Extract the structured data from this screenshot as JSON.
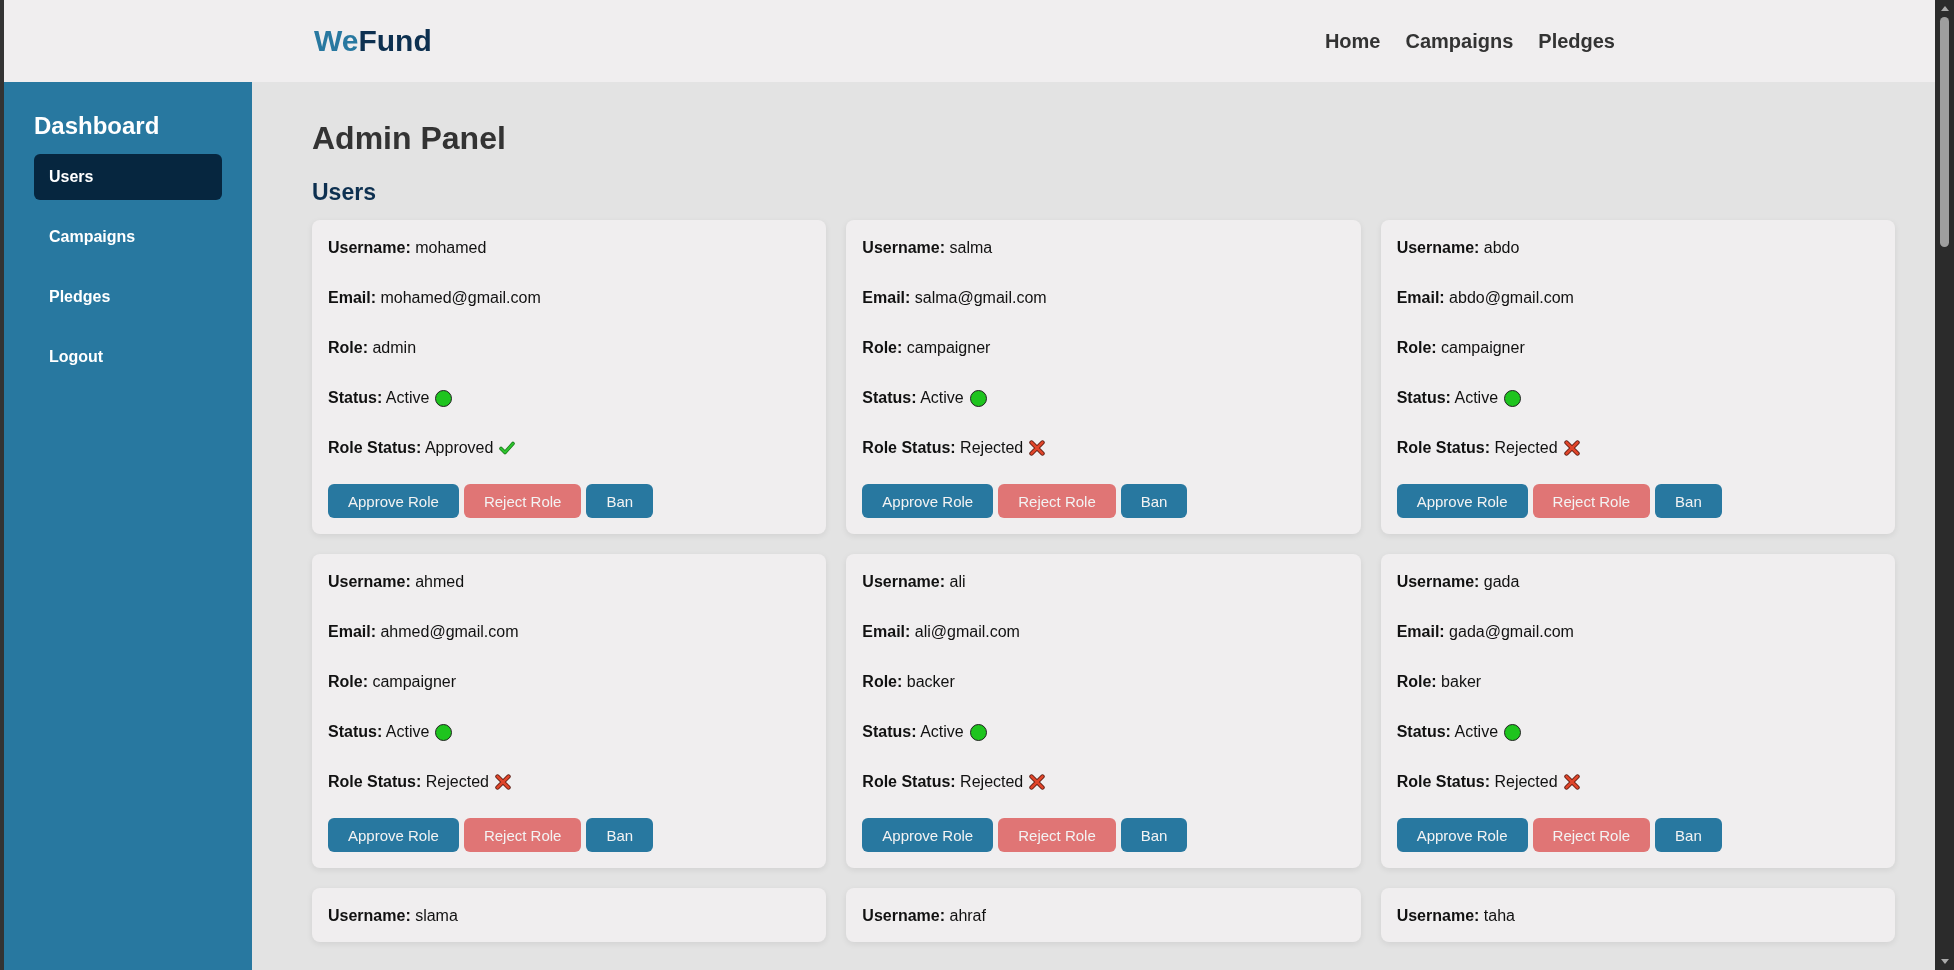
{
  "header": {
    "logo": {
      "first": "We",
      "second": "Fund"
    },
    "nav": [
      "Home",
      "Campaigns",
      "Pledges"
    ]
  },
  "sidebar": {
    "title": "Dashboard",
    "items": [
      {
        "label": "Users",
        "selected": true
      },
      {
        "label": "Campaigns",
        "selected": false
      },
      {
        "label": "Pledges",
        "selected": false
      },
      {
        "label": "Logout",
        "selected": false
      }
    ]
  },
  "main": {
    "title": "Admin Panel",
    "section": "Users",
    "users": [
      {
        "fields": [
          {
            "kind": "text",
            "label": "Username:",
            "value": "mohamed"
          },
          {
            "kind": "text",
            "label": "Email:",
            "value": "mohamed@gmail.com"
          },
          {
            "kind": "text",
            "label": "Role:",
            "value": "admin"
          },
          {
            "kind": "dot",
            "label": "Status:",
            "value": "Active",
            "color": "#1ec41e"
          },
          {
            "kind": "approved",
            "label": "Role Status:",
            "value": "Approved"
          }
        ],
        "buttons": [
          {
            "kind": "approve",
            "label": "Approve Role"
          },
          {
            "kind": "reject",
            "label": "Reject Role"
          },
          {
            "kind": "ban",
            "label": "Ban"
          }
        ]
      },
      {
        "fields": [
          {
            "kind": "text",
            "label": "Username:",
            "value": "salma"
          },
          {
            "kind": "text",
            "label": "Email:",
            "value": "salma@gmail.com"
          },
          {
            "kind": "text",
            "label": "Role:",
            "value": "campaigner"
          },
          {
            "kind": "dot",
            "label": "Status:",
            "value": "Active",
            "color": "#1ec41e"
          },
          {
            "kind": "rejected",
            "label": "Role Status:",
            "value": "Rejected"
          }
        ],
        "buttons": [
          {
            "kind": "approve",
            "label": "Approve Role"
          },
          {
            "kind": "reject",
            "label": "Reject Role"
          },
          {
            "kind": "ban",
            "label": "Ban"
          }
        ]
      },
      {
        "fields": [
          {
            "kind": "text",
            "label": "Username:",
            "value": "abdo"
          },
          {
            "kind": "text",
            "label": "Email:",
            "value": "abdo@gmail.com"
          },
          {
            "kind": "text",
            "label": "Role:",
            "value": "campaigner"
          },
          {
            "kind": "dot",
            "label": "Status:",
            "value": "Active",
            "color": "#1ec41e"
          },
          {
            "kind": "rejected",
            "label": "Role Status:",
            "value": "Rejected"
          }
        ],
        "buttons": [
          {
            "kind": "approve",
            "label": "Approve Role"
          },
          {
            "kind": "reject",
            "label": "Reject Role"
          },
          {
            "kind": "ban",
            "label": "Ban"
          }
        ]
      },
      {
        "fields": [
          {
            "kind": "text",
            "label": "Username:",
            "value": "ahmed"
          },
          {
            "kind": "text",
            "label": "Email:",
            "value": "ahmed@gmail.com"
          },
          {
            "kind": "text",
            "label": "Role:",
            "value": "campaigner"
          },
          {
            "kind": "dot",
            "label": "Status:",
            "value": "Active",
            "color": "#1ec41e"
          },
          {
            "kind": "rejected",
            "label": "Role Status:",
            "value": "Rejected"
          }
        ],
        "buttons": [
          {
            "kind": "approve",
            "label": "Approve Role"
          },
          {
            "kind": "reject",
            "label": "Reject Role"
          },
          {
            "kind": "ban",
            "label": "Ban"
          }
        ]
      },
      {
        "fields": [
          {
            "kind": "text",
            "label": "Username:",
            "value": "ali"
          },
          {
            "kind": "text",
            "label": "Email:",
            "value": "ali@gmail.com"
          },
          {
            "kind": "text",
            "label": "Role:",
            "value": "backer"
          },
          {
            "kind": "dot",
            "label": "Status:",
            "value": "Active",
            "color": "#1ec41e"
          },
          {
            "kind": "rejected",
            "label": "Role Status:",
            "value": "Rejected"
          }
        ],
        "buttons": [
          {
            "kind": "approve",
            "label": "Approve Role"
          },
          {
            "kind": "reject",
            "label": "Reject Role"
          },
          {
            "kind": "ban",
            "label": "Ban"
          }
        ]
      },
      {
        "fields": [
          {
            "kind": "text",
            "label": "Username:",
            "value": "gada"
          },
          {
            "kind": "text",
            "label": "Email:",
            "value": "gada@gmail.com"
          },
          {
            "kind": "text",
            "label": "Role:",
            "value": "baker"
          },
          {
            "kind": "dot",
            "label": "Status:",
            "value": "Active",
            "color": "#1ec41e"
          },
          {
            "kind": "rejected",
            "label": "Role Status:",
            "value": "Rejected"
          }
        ],
        "buttons": [
          {
            "kind": "approve",
            "label": "Approve Role"
          },
          {
            "kind": "reject",
            "label": "Reject Role"
          },
          {
            "kind": "ban",
            "label": "Ban"
          }
        ]
      },
      {
        "fields": [
          {
            "kind": "text",
            "label": "Username:",
            "value": "slama"
          }
        ]
      },
      {
        "fields": [
          {
            "kind": "text",
            "label": "Username:",
            "value": "ahraf"
          }
        ]
      },
      {
        "fields": [
          {
            "kind": "text",
            "label": "Username:",
            "value": "taha"
          }
        ]
      }
    ]
  }
}
